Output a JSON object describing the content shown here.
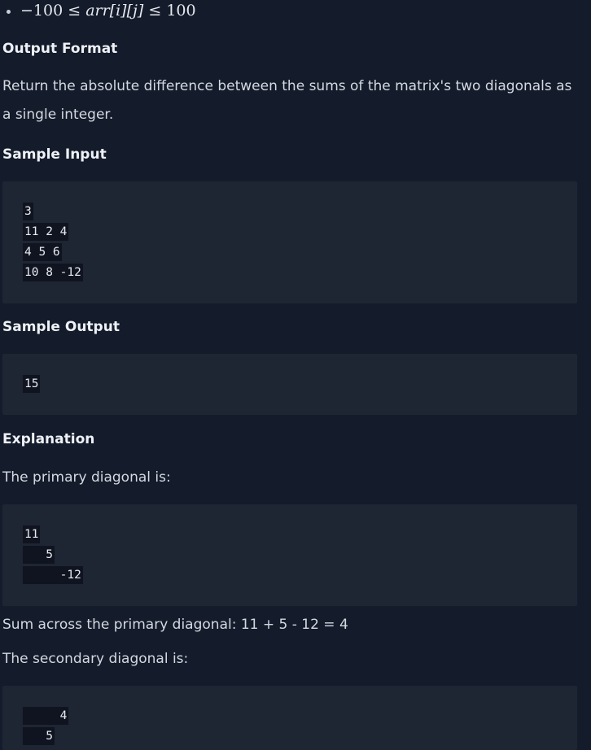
{
  "constraint": {
    "lhs": "−100",
    "rel1": " ≤ ",
    "var": "arr",
    "idx": "[i][j]",
    "rel2": " ≤ ",
    "rhs": "100"
  },
  "output_format": {
    "heading": "Output Format",
    "body": "Return the absolute difference between the sums of the matrix's two diagonals as a single integer."
  },
  "sample_input": {
    "heading": "Sample Input",
    "lines": [
      "3",
      "11 2 4",
      "4 5 6",
      "10 8 -12"
    ]
  },
  "sample_output": {
    "heading": "Sample Output",
    "lines": [
      "15"
    ]
  },
  "explanation": {
    "heading": "Explanation",
    "primary_intro": "The primary diagonal is:",
    "primary_lines": [
      "11",
      "   5",
      "     -12"
    ],
    "primary_sum": "Sum across the primary diagonal: 11 + 5 - 12 = 4",
    "secondary_intro": "The secondary diagonal is:",
    "secondary_lines": [
      "     4",
      "   5"
    ]
  }
}
